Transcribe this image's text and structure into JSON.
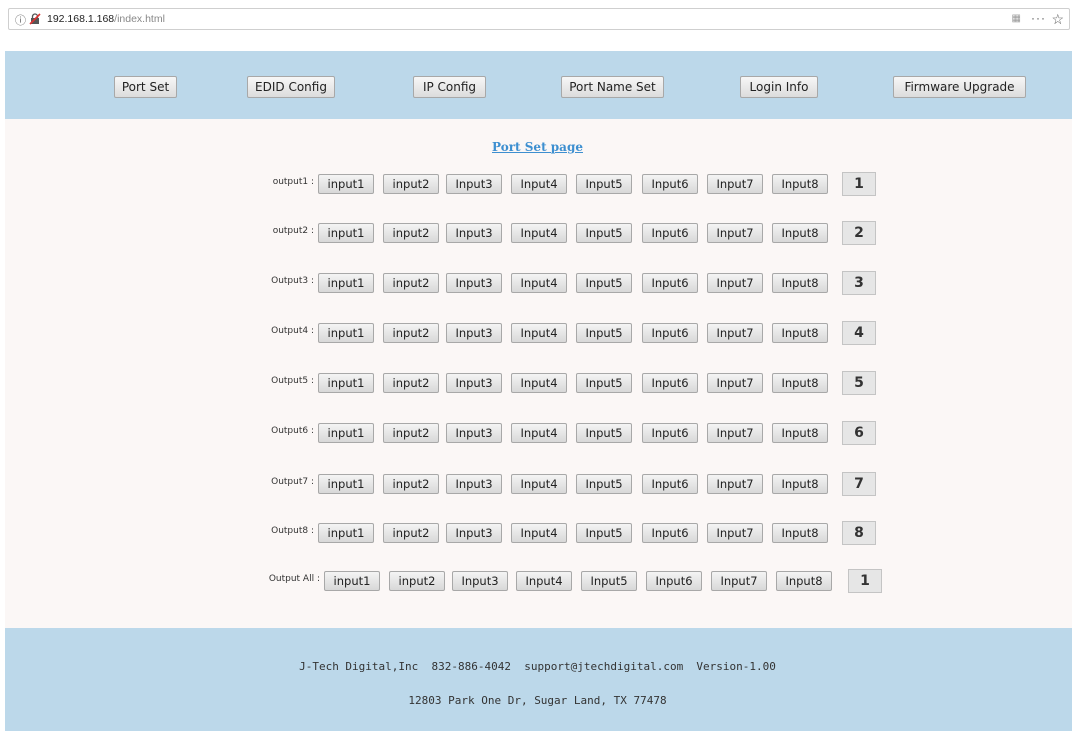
{
  "browser": {
    "url_host": "192.168.1.168",
    "url_path": "/index.html"
  },
  "nav": {
    "items": [
      {
        "label": "Port Set"
      },
      {
        "label": "EDID Config"
      },
      {
        "label": "IP Config"
      },
      {
        "label": "Port Name Set"
      },
      {
        "label": "Login Info"
      },
      {
        "label": "Firmware Upgrade"
      }
    ]
  },
  "page_title": "Port Set page",
  "rows": [
    {
      "label": "output1 :",
      "inputs": [
        "input1",
        "input2",
        "Input3",
        "Input4",
        "Input5",
        "Input6",
        "Input7",
        "Input8"
      ],
      "value": "1"
    },
    {
      "label": "output2 :",
      "inputs": [
        "input1",
        "input2",
        "Input3",
        "Input4",
        "Input5",
        "Input6",
        "Input7",
        "Input8"
      ],
      "value": "2"
    },
    {
      "label": "Output3 :",
      "inputs": [
        "input1",
        "input2",
        "Input3",
        "Input4",
        "Input5",
        "Input6",
        "Input7",
        "Input8"
      ],
      "value": "3"
    },
    {
      "label": "Output4 :",
      "inputs": [
        "input1",
        "input2",
        "Input3",
        "Input4",
        "Input5",
        "Input6",
        "Input7",
        "Input8"
      ],
      "value": "4"
    },
    {
      "label": "Output5 :",
      "inputs": [
        "input1",
        "input2",
        "Input3",
        "Input4",
        "Input5",
        "Input6",
        "Input7",
        "Input8"
      ],
      "value": "5"
    },
    {
      "label": "Output6 :",
      "inputs": [
        "input1",
        "input2",
        "Input3",
        "Input4",
        "Input5",
        "Input6",
        "Input7",
        "Input8"
      ],
      "value": "6"
    },
    {
      "label": "Output7 :",
      "inputs": [
        "input1",
        "input2",
        "Input3",
        "Input4",
        "Input5",
        "Input6",
        "Input7",
        "Input8"
      ],
      "value": "7"
    },
    {
      "label": "Output8 :",
      "inputs": [
        "input1",
        "input2",
        "Input3",
        "Input4",
        "Input5",
        "Input6",
        "Input7",
        "Input8"
      ],
      "value": "8"
    },
    {
      "label": "Output All :",
      "inputs": [
        "input1",
        "input2",
        "Input3",
        "Input4",
        "Input5",
        "Input6",
        "Input7",
        "Input8"
      ],
      "value": "1"
    }
  ],
  "footer": {
    "line1": "J-Tech Digital,Inc  832-886-4042  support@jtechdigital.com  Version-1.00",
    "line2": "12803 Park One Dr, Sugar Land, TX 77478"
  }
}
